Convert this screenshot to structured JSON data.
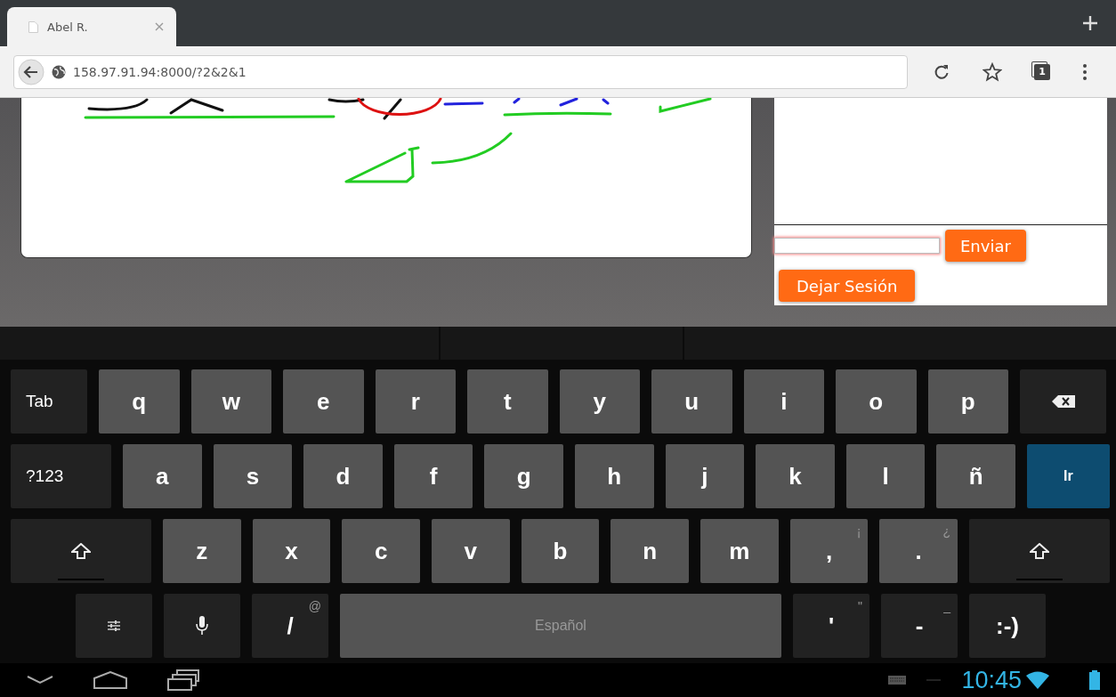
{
  "browser": {
    "tabs": [
      {
        "title": "Abel R.",
        "selected": true
      }
    ],
    "url": "158.97.91.94:8000/?2&2&1",
    "tab_count": "1"
  },
  "chat": {
    "input": {
      "focused": true
    },
    "send_button": "Enviar",
    "leave_button": "Dejar Sesión"
  },
  "keyboard": {
    "rows": [
      [
        {
          "kind": "label",
          "label": "Tab"
        },
        {
          "kind": "letter",
          "label": "q"
        },
        {
          "kind": "letter",
          "label": "w"
        },
        {
          "kind": "letter",
          "label": "e"
        },
        {
          "kind": "letter",
          "label": "r"
        },
        {
          "kind": "letter",
          "label": "t"
        },
        {
          "kind": "letter",
          "label": "y"
        },
        {
          "kind": "letter",
          "label": "u"
        },
        {
          "kind": "letter",
          "label": "i"
        },
        {
          "kind": "letter",
          "label": "o"
        },
        {
          "kind": "letter",
          "label": "p"
        },
        {
          "kind": "backspace"
        }
      ],
      [
        {
          "kind": "label",
          "label": "?123"
        },
        {
          "kind": "letter",
          "label": "a"
        },
        {
          "kind": "letter",
          "label": "s"
        },
        {
          "kind": "letter",
          "label": "d"
        },
        {
          "kind": "letter",
          "label": "f"
        },
        {
          "kind": "letter",
          "label": "g"
        },
        {
          "kind": "letter",
          "label": "h"
        },
        {
          "kind": "letter",
          "label": "j"
        },
        {
          "kind": "letter",
          "label": "k"
        },
        {
          "kind": "letter",
          "label": "l"
        },
        {
          "kind": "letter",
          "label": "ñ"
        },
        {
          "kind": "go",
          "label": "Ir"
        }
      ],
      [
        {
          "kind": "shift"
        },
        {
          "kind": "letter",
          "label": "z"
        },
        {
          "kind": "letter",
          "label": "x"
        },
        {
          "kind": "letter",
          "label": "c"
        },
        {
          "kind": "letter",
          "label": "v"
        },
        {
          "kind": "letter",
          "label": "b"
        },
        {
          "kind": "letter",
          "label": "n"
        },
        {
          "kind": "letter",
          "label": "m"
        },
        {
          "kind": "letter",
          "label": ",",
          "alt": "¡"
        },
        {
          "kind": "letter",
          "label": ".",
          "alt": "¿"
        },
        {
          "kind": "shift"
        }
      ],
      [
        {
          "kind": "settings"
        },
        {
          "kind": "mic"
        },
        {
          "kind": "symbol",
          "label": "/",
          "alt": "@"
        },
        {
          "kind": "space",
          "label": "Español"
        },
        {
          "kind": "symbol",
          "label": "'",
          "alt": "\""
        },
        {
          "kind": "symbol",
          "label": "-",
          "alt": "_"
        },
        {
          "kind": "symbol",
          "label": ":-)"
        }
      ]
    ]
  },
  "status_bar": {
    "time": "10:45"
  }
}
